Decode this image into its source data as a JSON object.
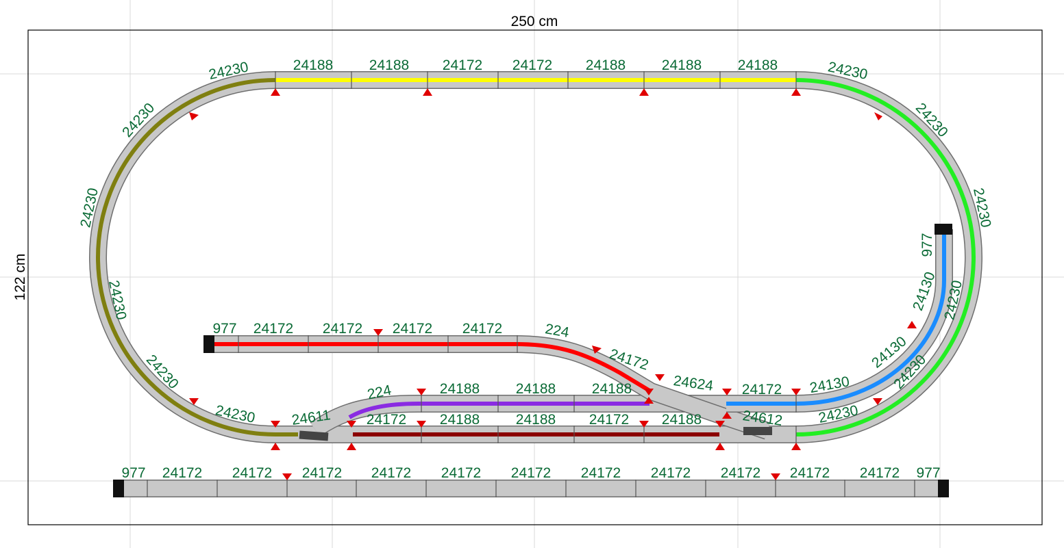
{
  "board": {
    "width_label": "250 cm",
    "height_label": "122 cm"
  },
  "colors": {
    "track_bed": "#c8c8c8",
    "track_edge": "#6e6e6e",
    "label": "#0a6a35",
    "route_olive": "#7f7f10",
    "route_yellow": "#ffff00",
    "route_green": "#22ee22",
    "route_blue": "#1a8cff",
    "route_red": "#ff0000",
    "route_purple": "#8a2be2",
    "route_darkred": "#8b0000",
    "insulator": "#e00000",
    "buffer": "#111111"
  },
  "track_labels": {
    "top_straight": [
      "24188",
      "24188",
      "24172",
      "24172",
      "24188",
      "24188",
      "24188"
    ],
    "left_curve": [
      "24230",
      "24230",
      "24230",
      "24230",
      "24230",
      "24230"
    ],
    "right_curve": [
      "24230",
      "24230",
      "24230",
      "24230",
      "24230",
      "24230"
    ],
    "upper_siding": [
      "977",
      "24172",
      "24172",
      "24172",
      "24172",
      "224",
      "24172"
    ],
    "crossover": "24624",
    "inner_right": [
      "24172",
      "24130",
      "24130",
      "24130",
      "977"
    ],
    "middle_loop": [
      "224",
      "24188",
      "24188",
      "24188"
    ],
    "lower_loop": [
      "24172",
      "24188",
      "24188",
      "24172",
      "24188"
    ],
    "switches": [
      "24611",
      "24612"
    ],
    "bottom_siding": [
      "977",
      "24172",
      "24172",
      "24172",
      "24172",
      "24172",
      "24172",
      "24172",
      "24172",
      "24172",
      "24172",
      "24172",
      "977"
    ]
  }
}
